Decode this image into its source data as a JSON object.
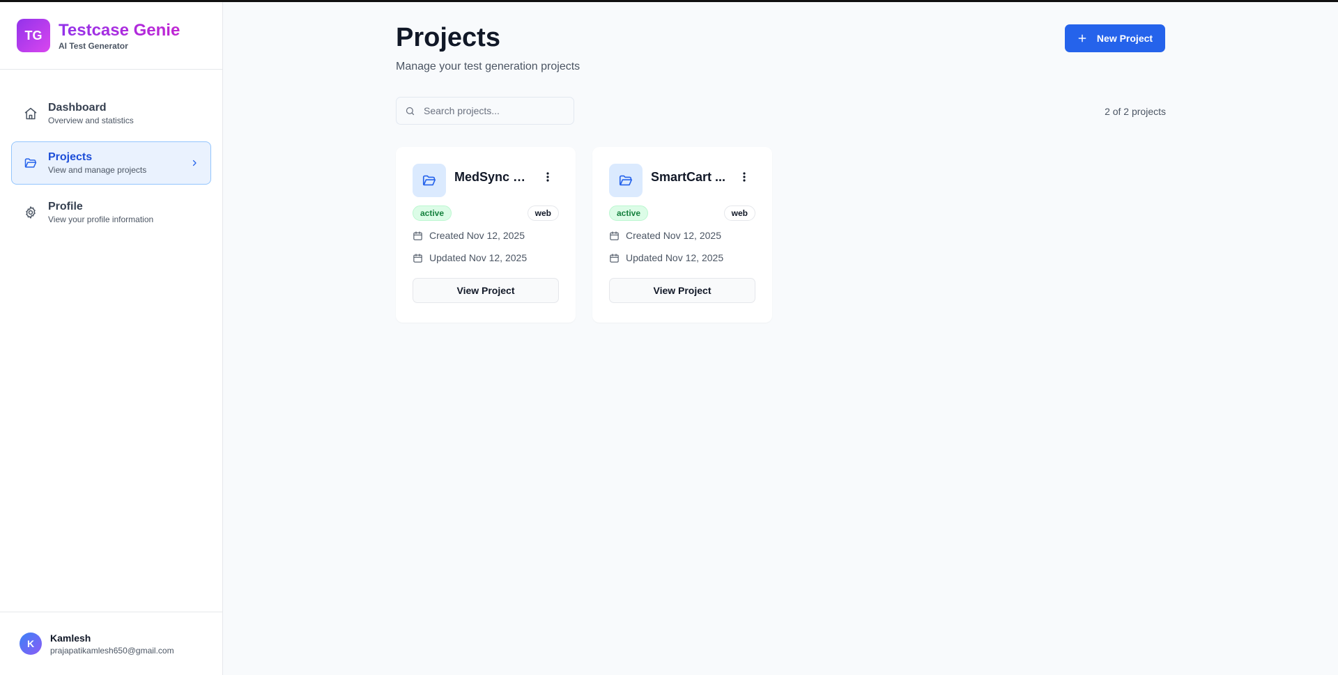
{
  "brand": {
    "logo_text": "TG",
    "title": "Testcase Genie",
    "subtitle": "AI Test Generator"
  },
  "nav": {
    "items": [
      {
        "label": "Dashboard",
        "description": "Overview and statistics",
        "icon": "home-icon",
        "active": false
      },
      {
        "label": "Projects",
        "description": "View and manage projects",
        "icon": "folder-open-icon",
        "active": true
      },
      {
        "label": "Profile",
        "description": "View your profile information",
        "icon": "gear-icon",
        "active": false
      }
    ]
  },
  "user": {
    "initial": "K",
    "name": "Kamlesh",
    "email": "prajapatikamlesh650@gmail.com"
  },
  "header": {
    "title": "Projects",
    "subtitle": "Manage your test generation projects",
    "new_button_label": "New Project"
  },
  "search": {
    "placeholder": "Search projects...",
    "value": ""
  },
  "results_count": "2 of 2 projects",
  "projects": [
    {
      "title": "MedSync P...",
      "status": "active",
      "type": "web",
      "created": "Created Nov 12, 2025",
      "updated": "Updated Nov 12, 2025",
      "view_label": "View Project"
    },
    {
      "title": "SmartCart ...",
      "status": "active",
      "type": "web",
      "created": "Created Nov 12, 2025",
      "updated": "Updated Nov 12, 2025",
      "view_label": "View Project"
    }
  ],
  "colors": {
    "accent": "#2563eb",
    "brand_gradient_start": "#9333ea",
    "brand_gradient_end": "#c026d3",
    "status_active_bg": "#dcfce7",
    "status_active_text": "#15803d",
    "active_nav_bg": "#eaf2fe"
  }
}
